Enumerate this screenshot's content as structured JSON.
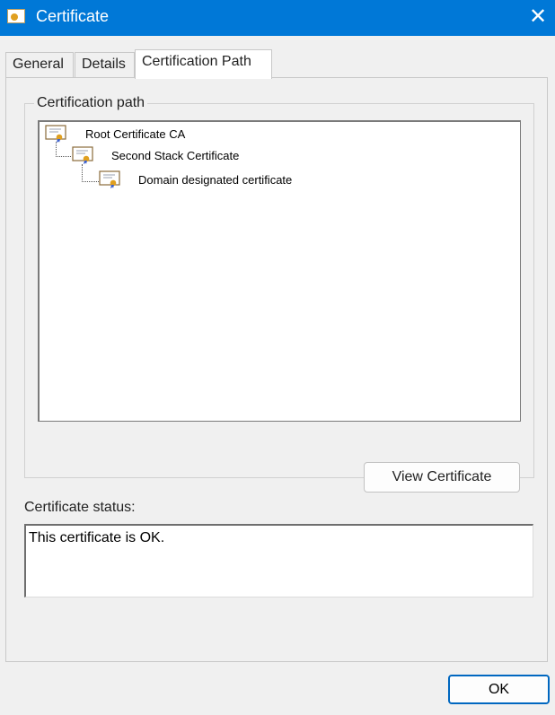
{
  "window": {
    "title": "Certificate",
    "close_glyph": "✕"
  },
  "tabs": [
    {
      "label": "General",
      "active": false
    },
    {
      "label": "Details",
      "active": false
    },
    {
      "label": "Certification Path",
      "active": true
    }
  ],
  "certification_path": {
    "legend": "Certification path",
    "nodes": [
      {
        "label": "Root Certificate CA",
        "icon": "certificate-icon",
        "level": 0
      },
      {
        "label": "Second Stack Certificate",
        "icon": "certificate-icon",
        "level": 1
      },
      {
        "label": "Domain designated certificate",
        "icon": "certificate-icon",
        "level": 2
      }
    ],
    "view_button_label": "View Certificate"
  },
  "status": {
    "label": "Certificate status:",
    "text": "This certificate is OK."
  },
  "footer": {
    "ok_label": "OK"
  },
  "colors": {
    "titlebar": "#0078d7",
    "accent_border": "#0067c0",
    "seal": "#e0a020",
    "ribbon": "#3a5fcd"
  }
}
